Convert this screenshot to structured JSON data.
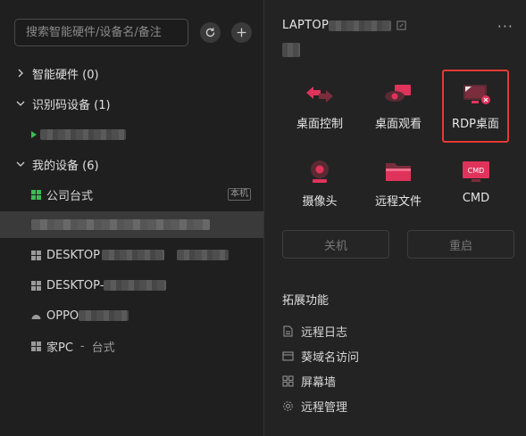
{
  "search": {
    "placeholder": "搜索智能硬件/设备名/备注"
  },
  "groups": {
    "smart": {
      "label": "智能硬件 (0)"
    },
    "idcode": {
      "label": "识别码设备 (1)"
    },
    "mine": {
      "label": "我的设备 (6)"
    }
  },
  "devices": [
    {
      "name": "公司台式",
      "tag": "本机"
    },
    {
      "name": ""
    },
    {
      "name": "DESKTOP"
    },
    {
      "name": "DESKTOP-"
    },
    {
      "name": "OPPO"
    },
    {
      "name": "家PC",
      "sep": "-",
      "remark": "台式"
    }
  ],
  "detail": {
    "title": "LAPTOP",
    "tiles": [
      {
        "label": "桌面控制",
        "icon": "desktop-control-icon"
      },
      {
        "label": "桌面观看",
        "icon": "desktop-view-icon"
      },
      {
        "label": "RDP桌面",
        "icon": "rdp-desktop-icon"
      },
      {
        "label": "摄像头",
        "icon": "camera-icon"
      },
      {
        "label": "远程文件",
        "icon": "remote-file-icon"
      },
      {
        "label": "CMD",
        "icon": "cmd-icon"
      }
    ],
    "shutdown_label": "关机",
    "restart_label": "重启",
    "ext_title": "拓展功能",
    "ext_items": [
      {
        "label": "远程日志",
        "icon": "log-icon"
      },
      {
        "label": "葵域名访问",
        "icon": "domain-icon"
      },
      {
        "label": "屏幕墙",
        "icon": "screen-wall-icon"
      },
      {
        "label": "远程管理",
        "icon": "gear-icon"
      }
    ]
  },
  "colors": {
    "accent": "#e0335b",
    "highlight_border": "#e53935"
  }
}
